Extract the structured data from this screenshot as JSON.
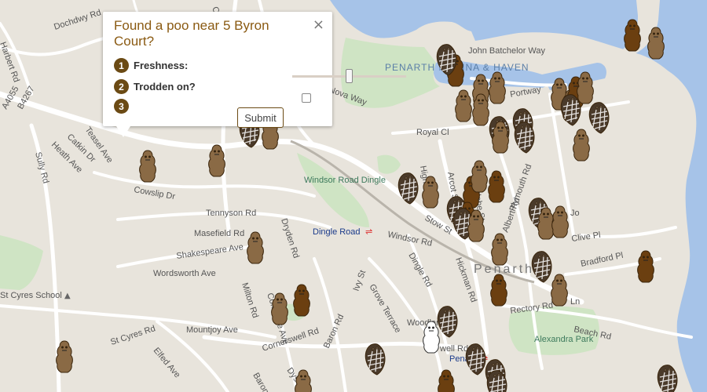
{
  "map": {
    "streets": [
      {
        "text": "Dochdwy Rd"
      },
      {
        "text": "Harbert Rd"
      },
      {
        "text": "A4055"
      },
      {
        "text": "B4267"
      },
      {
        "text": "Teasel Ave"
      },
      {
        "text": "Catkin Dr"
      },
      {
        "text": "Heath Ave"
      },
      {
        "text": "Sully Rd"
      },
      {
        "text": "Cowslip Dr"
      },
      {
        "text": "Tennyson Rd"
      },
      {
        "text": "Masefield Rd"
      },
      {
        "text": "Shakespeare Ave"
      },
      {
        "text": "Wordsworth Ave"
      },
      {
        "text": "Dryden Rd"
      },
      {
        "text": "Milton Rd"
      },
      {
        "text": "Coleridge Ave"
      },
      {
        "text": "Mountjoy Ave"
      },
      {
        "text": "St Cyres Rd"
      },
      {
        "text": "Elfed Ave"
      },
      {
        "text": "Cornerswell Rd"
      },
      {
        "text": "Dyserth Rd"
      },
      {
        "text": "Baron Rd"
      },
      {
        "text": "Barons"
      },
      {
        "text": "Ivy St"
      },
      {
        "text": "Grove Terrace"
      },
      {
        "text": "Woodland"
      },
      {
        "text": "Dingle Rd"
      },
      {
        "text": "Windsor Rd"
      },
      {
        "text": "Hickman Rd"
      },
      {
        "text": "Albert Rd"
      },
      {
        "text": "Clive Pl"
      },
      {
        "text": "Bradford Pl"
      },
      {
        "text": "Rectory Rd"
      },
      {
        "text": "Beach Rd"
      },
      {
        "text": "Royal Cl"
      },
      {
        "text": "Nova Way"
      },
      {
        "text": "Portway"
      },
      {
        "text": "John Batchelor Way"
      },
      {
        "text": "Glebe St"
      },
      {
        "text": "Arcot St"
      },
      {
        "text": "High St"
      },
      {
        "text": "Plymouth Rd"
      },
      {
        "text": "Stow St"
      },
      {
        "text": "Jo"
      },
      {
        "text": "Ln"
      },
      {
        "text": "well Rd"
      },
      {
        "text": "Ludlow"
      },
      {
        "text": "Ceneywy"
      },
      {
        "text": "Rd"
      }
    ],
    "areas": {
      "windsor": "Windsor Road Dingle",
      "alexandra": "Alexandra Park",
      "marina": "PENARTH MARINA & HAVEN",
      "penarth": "Penarth",
      "school": "St Cyres School",
      "dingle_station": "Dingle Road",
      "penarth_station": "Penarth"
    }
  },
  "popup": {
    "title": "Found a poo near 5 Byron Court?",
    "close": "×",
    "step1_num": "1",
    "step1_label": "Freshness:",
    "freshness": 0.5,
    "step2_num": "2",
    "step2_label": "Trodden on?",
    "trodden": false,
    "step3_num": "3",
    "submit_label": "Submit"
  },
  "markers": {
    "fresh_color": "#6b3f10",
    "old_color": "#8a6a45",
    "trodden_color": "#4a3a2a",
    "selected_color": "#ffffff"
  },
  "icons": {
    "poo": "poo-icon",
    "trodden": "trodden-poo-icon",
    "rail": "rail-icon",
    "school": "school-icon"
  }
}
